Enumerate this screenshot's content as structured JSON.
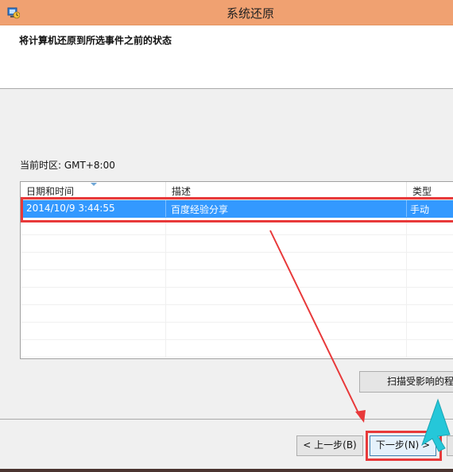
{
  "window": {
    "title": "系统还原"
  },
  "header": {
    "instruction": "将计算机还原到所选事件之前的状态"
  },
  "timezone_label": "当前时区: GMT+8:00",
  "table": {
    "columns": [
      "日期和时间",
      "描述",
      "类型"
    ],
    "rows": [
      {
        "date": "2014/10/9 3:44:55",
        "description": "百度经验分享",
        "type": "手动",
        "selected": true
      }
    ]
  },
  "buttons": {
    "scan": "扫描受影响的程",
    "back": "< 上一步(B)",
    "next": "下一步(N) >"
  },
  "colors": {
    "titlebar": "#f0a171",
    "selection": "#3399ff",
    "annotation_red": "#e8393a",
    "annotation_cyan": "#25c7d9"
  },
  "icons": [
    "system-restore-icon",
    "sort-arrow-icon"
  ]
}
